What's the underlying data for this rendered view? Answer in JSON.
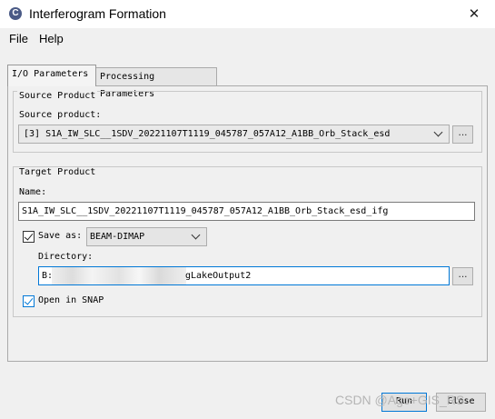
{
  "window": {
    "title": "Interferogram Formation",
    "close_glyph": "✕",
    "app_icon_glyph": "C"
  },
  "menu": {
    "file": "File",
    "help": "Help"
  },
  "tabs": [
    {
      "label": "I/O Parameters",
      "selected": true
    },
    {
      "label": "Processing Parameters",
      "selected": false
    }
  ],
  "source": {
    "group_title": "Source Product",
    "label": "Source product:",
    "selected_value": "[3] S1A_IW_SLC__1SDV_20221107T1119_045787_057A12_A1BB_Orb_Stack_esd",
    "browse_label": "..."
  },
  "target": {
    "group_title": "Target Product",
    "name_label": "Name:",
    "name_value": "S1A_IW_SLC__1SDV_20221107T1119_045787_057A12_A1BB_Orb_Stack_esd_ifg",
    "save_as_label": "Save as:",
    "save_as_checked": true,
    "format_value": "BEAM-DIMAP",
    "directory_label": "Directory:",
    "directory_prefix": "B:\\F",
    "directory_suffix": "gLakeOutput2",
    "browse_label": "...",
    "open_in_snap_label": "Open in SNAP",
    "open_in_snap_checked": true
  },
  "buttons": {
    "run": "Run",
    "close": "Close"
  },
  "watermark": "CSDN @Ago+GIS_RS",
  "colors": {
    "focus_accent": "#0078d7"
  }
}
